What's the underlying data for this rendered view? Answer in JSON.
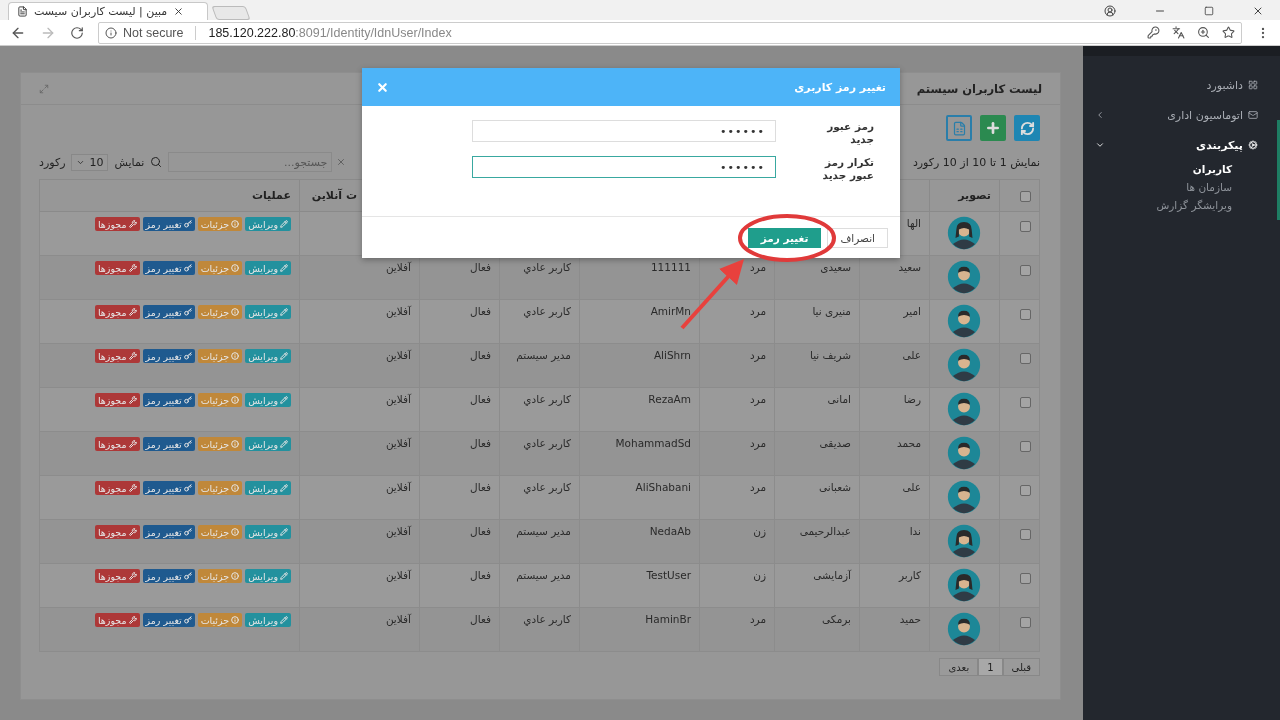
{
  "browser": {
    "tab_title": "مبین | لیست کاربران سیست",
    "security": "Not secure",
    "url_host": "185.120.222.80",
    "url_path": ":8091/Identity/IdnUser/Index"
  },
  "sidebar": {
    "items": [
      {
        "label": "داشبورد",
        "kind": "link",
        "expanded": false
      },
      {
        "label": "اتوماسیون اداری",
        "kind": "group",
        "expanded": false
      },
      {
        "label": "پیکربندی",
        "kind": "group",
        "expanded": true,
        "children": [
          {
            "label": "کاربران",
            "selected": true
          },
          {
            "label": "سازمان ها",
            "selected": false
          },
          {
            "label": "ویرایشگر گزارش",
            "selected": false
          }
        ]
      }
    ]
  },
  "panel": {
    "title": "لیست کاربران سیستم",
    "toolbar": [
      {
        "kind": "refresh"
      },
      {
        "kind": "add"
      },
      {
        "kind": "excel"
      }
    ],
    "info": "نمایش 1 تا 10 از 10 رکورد",
    "page_size": {
      "before": "نمایش",
      "value": "10",
      "after": "رکورد"
    },
    "search": {
      "placeholder": "جستجو..."
    },
    "header": {
      "checked": false,
      "picture": "تصویر",
      "online": "ت آنلاین",
      "actions": "عملیات"
    },
    "rows": [
      {
        "checked": false,
        "kind": "female",
        "first_name": "الها",
        "actions": [
          {
            "kind": "edit",
            "label": "ویرایش"
          },
          {
            "kind": "details",
            "label": "جزئیات"
          },
          {
            "kind": "password",
            "label": "تغییر رمز"
          },
          {
            "kind": "permissions",
            "label": "مجوزها"
          }
        ]
      },
      {
        "checked": false,
        "kind": "male",
        "first_name": "سعید",
        "last_name": "سعیدی",
        "gender": "مرد",
        "username": "111111",
        "role": "کاربر عادي",
        "status": "فعال",
        "online": "آفلاین",
        "actions": [
          {
            "kind": "edit",
            "label": "ویرایش"
          },
          {
            "kind": "details",
            "label": "جزئیات"
          },
          {
            "kind": "password",
            "label": "تغییر رمز"
          },
          {
            "kind": "permissions",
            "label": "مجوزها"
          }
        ]
      },
      {
        "checked": false,
        "kind": "male",
        "first_name": "امیر",
        "last_name": "منیری نیا",
        "gender": "مرد",
        "username": "AmirMn",
        "role": "کاربر عادي",
        "status": "فعال",
        "online": "آفلاین",
        "actions": [
          {
            "kind": "edit",
            "label": "ویرایش"
          },
          {
            "kind": "details",
            "label": "جزئیات"
          },
          {
            "kind": "password",
            "label": "تغییر رمز"
          },
          {
            "kind": "permissions",
            "label": "مجوزها"
          }
        ]
      },
      {
        "checked": false,
        "kind": "male",
        "first_name": "علی",
        "last_name": "شریف نیا",
        "gender": "مرد",
        "username": "AliShrn",
        "role": "مدیر سیستم",
        "status": "فعال",
        "online": "آفلاین",
        "actions": [
          {
            "kind": "edit",
            "label": "ویرایش"
          },
          {
            "kind": "details",
            "label": "جزئیات"
          },
          {
            "kind": "password",
            "label": "تغییر رمز"
          },
          {
            "kind": "permissions",
            "label": "مجوزها"
          }
        ]
      },
      {
        "checked": false,
        "kind": "male",
        "first_name": "رضا",
        "last_name": "امانی",
        "gender": "مرد",
        "username": "RezaAm",
        "role": "کاربر عادي",
        "status": "فعال",
        "online": "آفلاین",
        "actions": [
          {
            "kind": "edit",
            "label": "ویرایش"
          },
          {
            "kind": "details",
            "label": "جزئیات"
          },
          {
            "kind": "password",
            "label": "تغییر رمز"
          },
          {
            "kind": "permissions",
            "label": "مجوزها"
          }
        ]
      },
      {
        "checked": false,
        "kind": "male",
        "first_name": "محمد",
        "last_name": "صدیقی",
        "gender": "مرد",
        "username": "MohammadSd",
        "role": "کاربر عادي",
        "status": "فعال",
        "online": "آفلاین",
        "actions": [
          {
            "kind": "edit",
            "label": "ویرایش"
          },
          {
            "kind": "details",
            "label": "جزئیات"
          },
          {
            "kind": "password",
            "label": "تغییر رمز"
          },
          {
            "kind": "permissions",
            "label": "مجوزها"
          }
        ]
      },
      {
        "checked": false,
        "kind": "male",
        "first_name": "علی",
        "last_name": "شعبانی",
        "gender": "مرد",
        "username": "AliShabani",
        "role": "کاربر عادي",
        "status": "فعال",
        "online": "آفلاین",
        "actions": [
          {
            "kind": "edit",
            "label": "ویرایش"
          },
          {
            "kind": "details",
            "label": "جزئیات"
          },
          {
            "kind": "password",
            "label": "تغییر رمز"
          },
          {
            "kind": "permissions",
            "label": "مجوزها"
          }
        ]
      },
      {
        "checked": false,
        "kind": "female",
        "first_name": "ندا",
        "last_name": "عبدالرحیمی",
        "gender": "زن",
        "username": "NedaAb",
        "role": "مدیر سیستم",
        "status": "فعال",
        "online": "آفلاین",
        "actions": [
          {
            "kind": "edit",
            "label": "ویرایش"
          },
          {
            "kind": "details",
            "label": "جزئیات"
          },
          {
            "kind": "password",
            "label": "تغییر رمز"
          },
          {
            "kind": "permissions",
            "label": "مجوزها"
          }
        ]
      },
      {
        "checked": false,
        "kind": "female",
        "first_name": "کاربر",
        "last_name": "آزمایشی",
        "gender": "زن",
        "username": "TestUser",
        "role": "مدیر سیستم",
        "status": "فعال",
        "online": "آفلاین",
        "actions": [
          {
            "kind": "edit",
            "label": "ویرایش"
          },
          {
            "kind": "details",
            "label": "جزئیات"
          },
          {
            "kind": "password",
            "label": "تغییر رمز"
          },
          {
            "kind": "permissions",
            "label": "مجوزها"
          }
        ]
      },
      {
        "checked": false,
        "kind": "male",
        "first_name": "حمید",
        "last_name": "برمکی",
        "gender": "مرد",
        "username": "HaminBr",
        "role": "کاربر عادي",
        "status": "فعال",
        "online": "آفلاین",
        "actions": [
          {
            "kind": "edit",
            "label": "ویرایش"
          },
          {
            "kind": "details",
            "label": "جزئیات"
          },
          {
            "kind": "password",
            "label": "تغییر رمز"
          },
          {
            "kind": "permissions",
            "label": "مجوزها"
          }
        ]
      }
    ],
    "pagination": [
      {
        "label": "قبلی",
        "selected": false
      },
      {
        "label": "1",
        "selected": true
      },
      {
        "label": "بعدی",
        "selected": false
      }
    ]
  },
  "modal": {
    "title": "تغییر رمز کاربری",
    "fields": [
      {
        "label": "رمز عبور جدید",
        "value": "••••••",
        "focused": false
      },
      {
        "label": "تکرار رمز عبور جدید",
        "value": "••••••",
        "focused": true
      }
    ],
    "buttons": [
      {
        "kind": "default",
        "label": "انصراف"
      },
      {
        "kind": "primary",
        "label": "تغییر رمز"
      }
    ]
  }
}
